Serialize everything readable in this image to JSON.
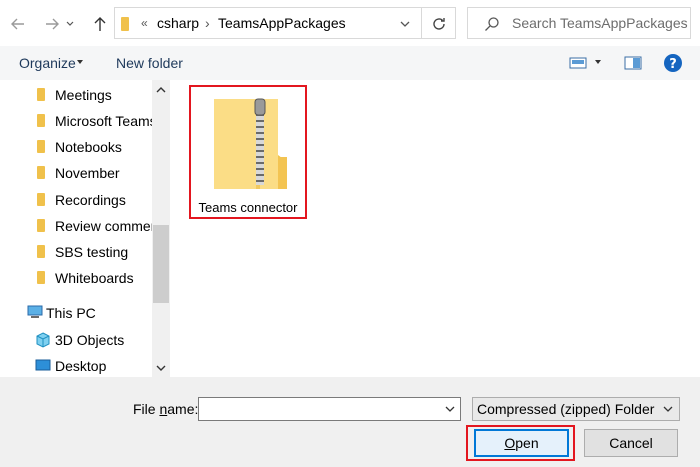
{
  "address": {
    "overflow": "«",
    "segments": [
      "csharp",
      "TeamsAppPackages"
    ]
  },
  "search": {
    "placeholder": "Search TeamsAppPackages"
  },
  "toolbar": {
    "organize": "Organize",
    "new_folder": "New folder"
  },
  "nav": {
    "folders": [
      "Meetings",
      "Microsoft Teams",
      "Notebooks",
      "November",
      "Recordings",
      "Review comments",
      "SBS testing",
      "Whiteboards"
    ],
    "this_pc": "This PC",
    "pc_items": [
      "3D Objects",
      "Desktop"
    ]
  },
  "content": {
    "items": [
      {
        "name": "Teams connector"
      }
    ]
  },
  "bottom": {
    "file_name_label_pre": "File ",
    "file_name_label_u": "n",
    "file_name_label_post": "ame:",
    "file_name_value": "",
    "file_type": "Compressed (zipped) Folder",
    "open_pre": "",
    "open_u": "O",
    "open_post": "pen",
    "cancel": "Cancel"
  },
  "colors": {
    "accent": "#0078d7",
    "highlight": "#e3161f",
    "folder": "#f0c14b"
  }
}
